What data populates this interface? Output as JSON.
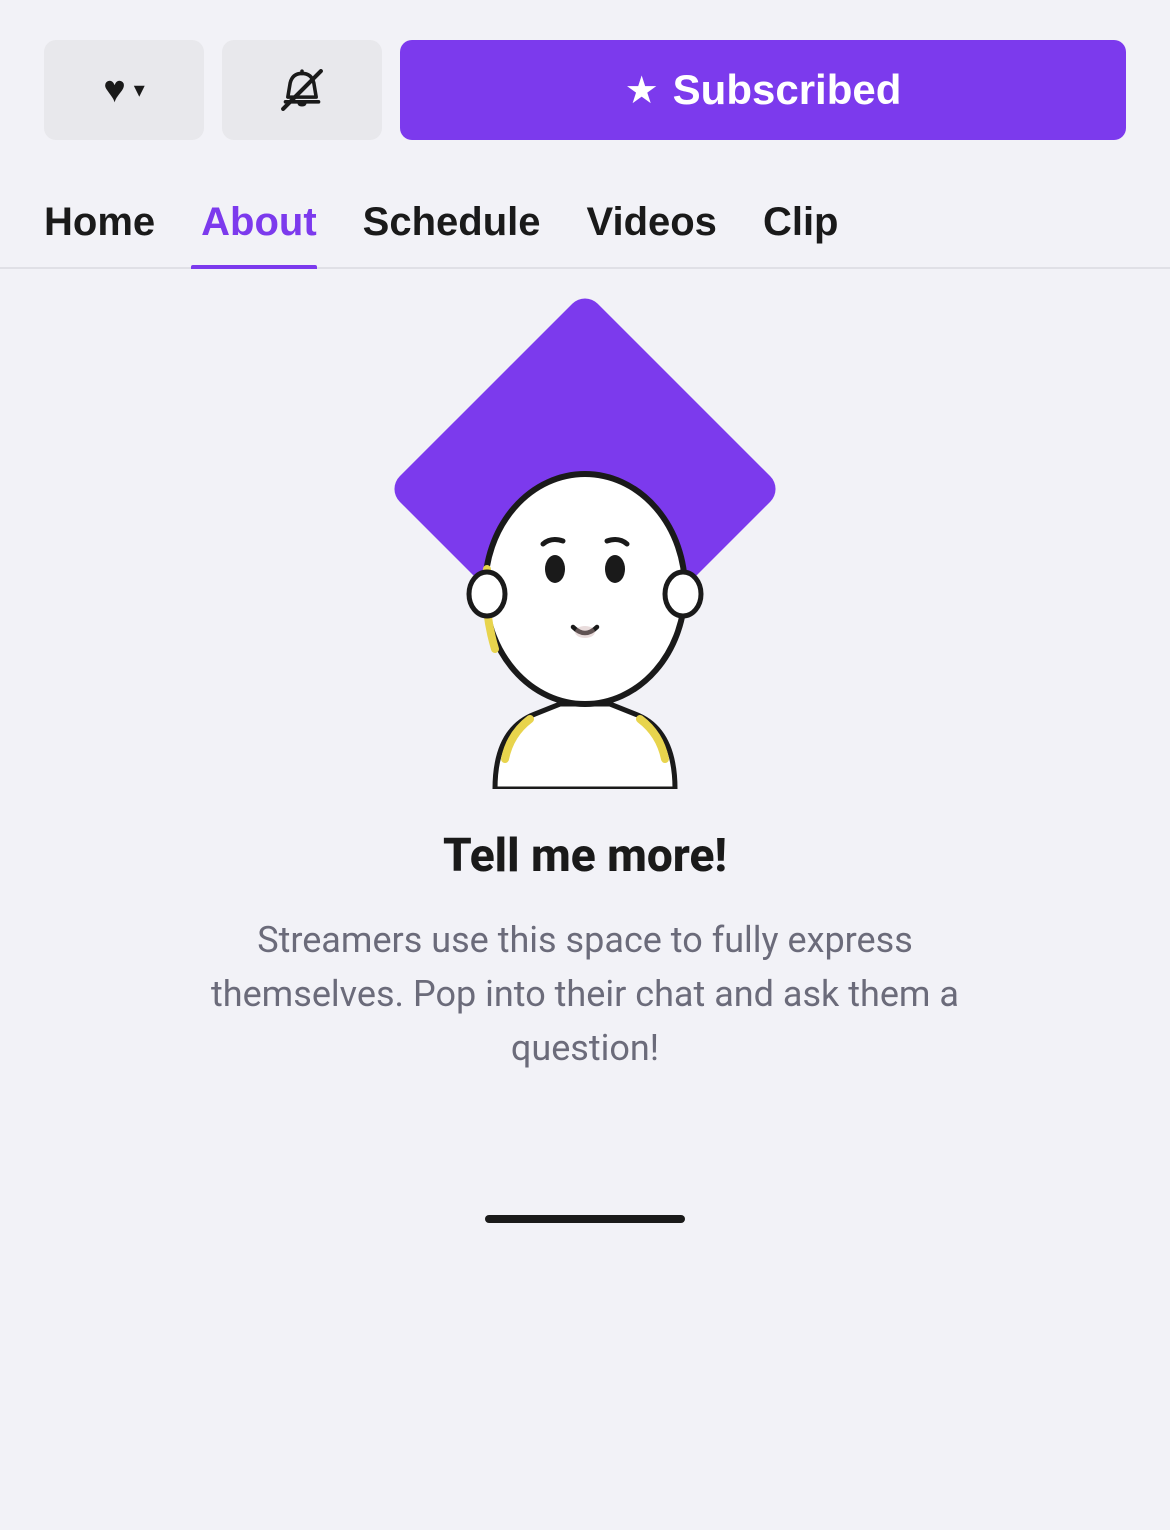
{
  "toolbar": {
    "heart_button": {
      "label": "♥",
      "chevron": "▾",
      "aria": "Follow with dropdown"
    },
    "bell_button": {
      "aria": "Notifications off"
    },
    "subscribed_button": {
      "label": "Subscribed",
      "star": "★"
    }
  },
  "nav": {
    "tabs": [
      {
        "id": "home",
        "label": "Home",
        "active": false
      },
      {
        "id": "about",
        "label": "About",
        "active": true
      },
      {
        "id": "schedule",
        "label": "Schedule",
        "active": false
      },
      {
        "id": "videos",
        "label": "Videos",
        "active": false
      },
      {
        "id": "clips",
        "label": "Clip",
        "active": false,
        "clipped": true
      }
    ]
  },
  "content": {
    "title": "Tell me more!",
    "description": "Streamers use this space to fully express themselves. Pop into their chat and ask them a question!",
    "character_alt": "Twitch-style mascot character"
  },
  "colors": {
    "purple": "#7c3aed",
    "bg": "#f2f2f7",
    "dark": "#1a1a1a",
    "gray": "#6b6b7a",
    "button_bg": "#e8e8ec"
  }
}
